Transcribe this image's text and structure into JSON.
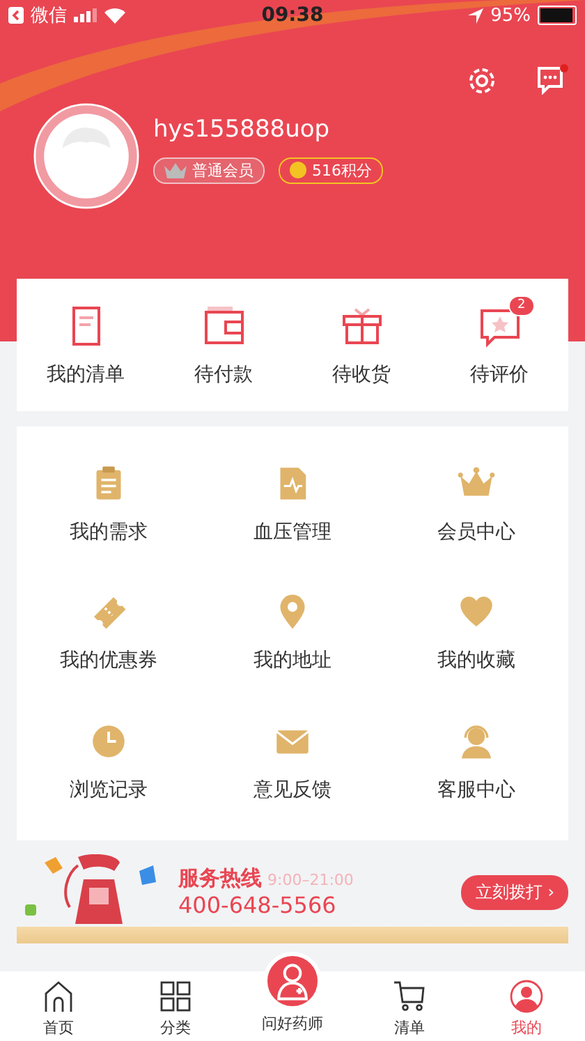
{
  "status_bar": {
    "back_app": "微信",
    "time": "09:38",
    "battery": "95%"
  },
  "header": {
    "message_unread": true
  },
  "profile": {
    "username": "hys155888uop",
    "member_level": "普通会员",
    "points": "516积分"
  },
  "orders": [
    {
      "label": "我的清单"
    },
    {
      "label": "待付款"
    },
    {
      "label": "待收货"
    },
    {
      "label": "待评价",
      "badge": "2"
    }
  ],
  "services": [
    {
      "label": "我的需求"
    },
    {
      "label": "血压管理"
    },
    {
      "label": "会员中心"
    },
    {
      "label": "我的优惠券"
    },
    {
      "label": "我的地址"
    },
    {
      "label": "我的收藏"
    },
    {
      "label": "浏览记录"
    },
    {
      "label": "意见反馈"
    },
    {
      "label": "客服中心"
    }
  ],
  "hotline": {
    "title": "服务热线",
    "hours": "9:00–21:00",
    "number": "400-648-5566",
    "button": "立刻拨打 ›"
  },
  "tab_bar": [
    {
      "label": "首页",
      "kind": "normal",
      "selected": false
    },
    {
      "label": "分类",
      "kind": "normal",
      "selected": false
    },
    {
      "label": "问好药师",
      "kind": "center",
      "selected": false
    },
    {
      "label": "清单",
      "kind": "normal",
      "selected": false
    },
    {
      "label": "我的",
      "kind": "normal",
      "selected": true
    }
  ]
}
